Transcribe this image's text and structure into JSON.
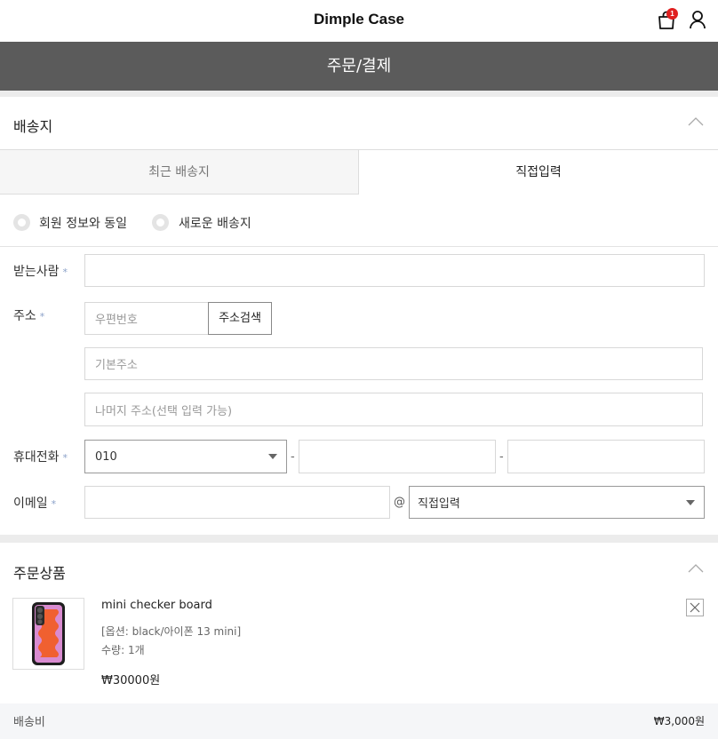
{
  "header": {
    "brand": "Dimple Case",
    "cart_count": "1"
  },
  "page_title": "주문/결제",
  "shipping": {
    "title": "배송지",
    "tabs": [
      {
        "label": "최근 배송지"
      },
      {
        "label": "직접입력"
      }
    ],
    "radios": [
      {
        "label": "회원 정보와 동일"
      },
      {
        "label": "새로운 배송지"
      }
    ],
    "fields": {
      "recipient": {
        "label": "받는사람",
        "required_mark": "*",
        "value": ""
      },
      "address": {
        "label": "주소",
        "required_mark": "*",
        "zip_placeholder": "우편번호",
        "search_button": "주소검색",
        "base_placeholder": "기본주소",
        "detail_placeholder": "나머지 주소(선택 입력 가능)"
      },
      "phone": {
        "label": "휴대전화",
        "required_mark": "*",
        "prefix": "010",
        "separator": "-"
      },
      "email": {
        "label": "이메일",
        "required_mark": "*",
        "at": "@",
        "domain_select": "직접입력"
      }
    }
  },
  "order": {
    "title": "주문상품",
    "item": {
      "name": "mini checker board",
      "option": "[옵션: black/아이폰 13 mini]",
      "quantity": "수량: 1개",
      "price": "₩30000원"
    },
    "shipping_fee": {
      "label": "배송비",
      "value": "₩3,000원"
    }
  },
  "icons": [
    "cart-icon",
    "user-icon",
    "chevron-up-icon",
    "close-icon",
    "chevron-down-icon"
  ]
}
